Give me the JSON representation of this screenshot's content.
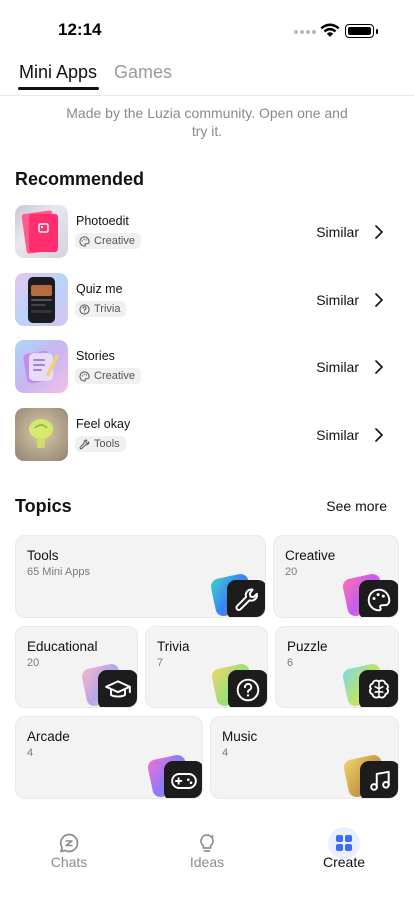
{
  "status_bar": {
    "time": "12:14"
  },
  "tabs": [
    {
      "label": "Mini Apps",
      "active": true
    },
    {
      "label": "Games",
      "active": false
    }
  ],
  "intro": "Made by the Luzia community. Open one and try it.",
  "recommended": {
    "title": "Recommended",
    "similar_label": "Similar",
    "items": [
      {
        "name": "Photoedit",
        "tag": "Creative",
        "tag_icon": "palette-icon"
      },
      {
        "name": "Quiz me",
        "tag": "Trivia",
        "tag_icon": "question-icon"
      },
      {
        "name": "Stories",
        "tag": "Creative",
        "tag_icon": "palette-icon"
      },
      {
        "name": "Feel okay",
        "tag": "Tools",
        "tag_icon": "wrench-icon"
      }
    ]
  },
  "topics": {
    "title": "Topics",
    "see_more": "See more",
    "items": [
      {
        "name": "Tools",
        "count": "65 Mini Apps",
        "icon": "wrench-icon"
      },
      {
        "name": "Creative",
        "count": "20",
        "icon": "palette-icon"
      },
      {
        "name": "Educational",
        "count": "20",
        "icon": "graduation-cap-icon"
      },
      {
        "name": "Trivia",
        "count": "7",
        "icon": "question-icon"
      },
      {
        "name": "Puzzle",
        "count": "6",
        "icon": "brain-icon"
      },
      {
        "name": "Arcade",
        "count": "4",
        "icon": "gamepad-icon"
      },
      {
        "name": "Music",
        "count": "4",
        "icon": "music-note-icon"
      }
    ]
  },
  "bottom_nav": [
    {
      "label": "Chats",
      "icon": "chat-icon",
      "active": false
    },
    {
      "label": "Ideas",
      "icon": "lightbulb-icon",
      "active": false
    },
    {
      "label": "Create",
      "icon": "grid-icon",
      "active": true
    }
  ],
  "colors": {
    "accent": "#3b6cf6",
    "active_tab": "#111111",
    "inactive_tab": "#9a9a9a",
    "card_bg": "#f3f3f3"
  }
}
